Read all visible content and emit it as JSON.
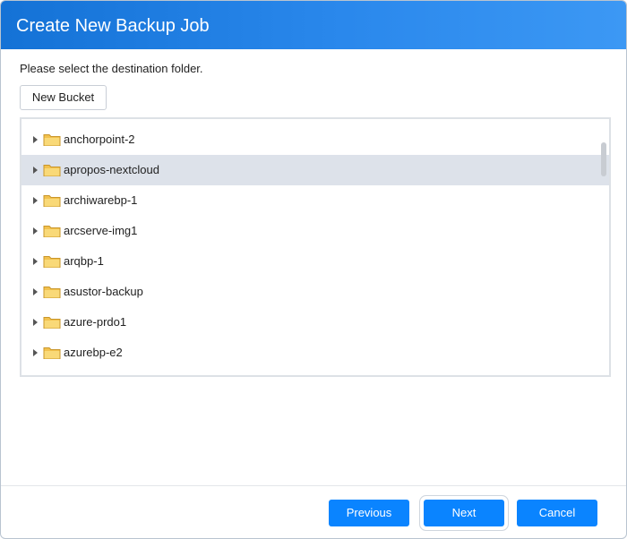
{
  "dialog": {
    "title": "Create New Backup Job",
    "prompt": "Please select the destination folder."
  },
  "toolbar": {
    "new_bucket_label": "New Bucket"
  },
  "tree": {
    "selected_index": 1,
    "items": [
      {
        "label": "anchorpoint-2",
        "icon": "folder-icon"
      },
      {
        "label": "apropos-nextcloud",
        "icon": "folder-icon"
      },
      {
        "label": "archiwarebp-1",
        "icon": "folder-icon"
      },
      {
        "label": "arcserve-img1",
        "icon": "folder-icon"
      },
      {
        "label": "arqbp-1",
        "icon": "folder-icon"
      },
      {
        "label": "asustor-backup",
        "icon": "folder-icon"
      },
      {
        "label": "azure-prdo1",
        "icon": "folder-icon"
      },
      {
        "label": "azurebp-e2",
        "icon": "folder-icon"
      }
    ]
  },
  "footer": {
    "previous_label": "Previous",
    "next_label": "Next",
    "cancel_label": "Cancel"
  },
  "colors": {
    "accent": "#0a84ff",
    "title_gradient_start": "#1472d6",
    "title_gradient_end": "#3c98f4",
    "selected_row": "#dde2ea",
    "folder": "#f5c453"
  }
}
